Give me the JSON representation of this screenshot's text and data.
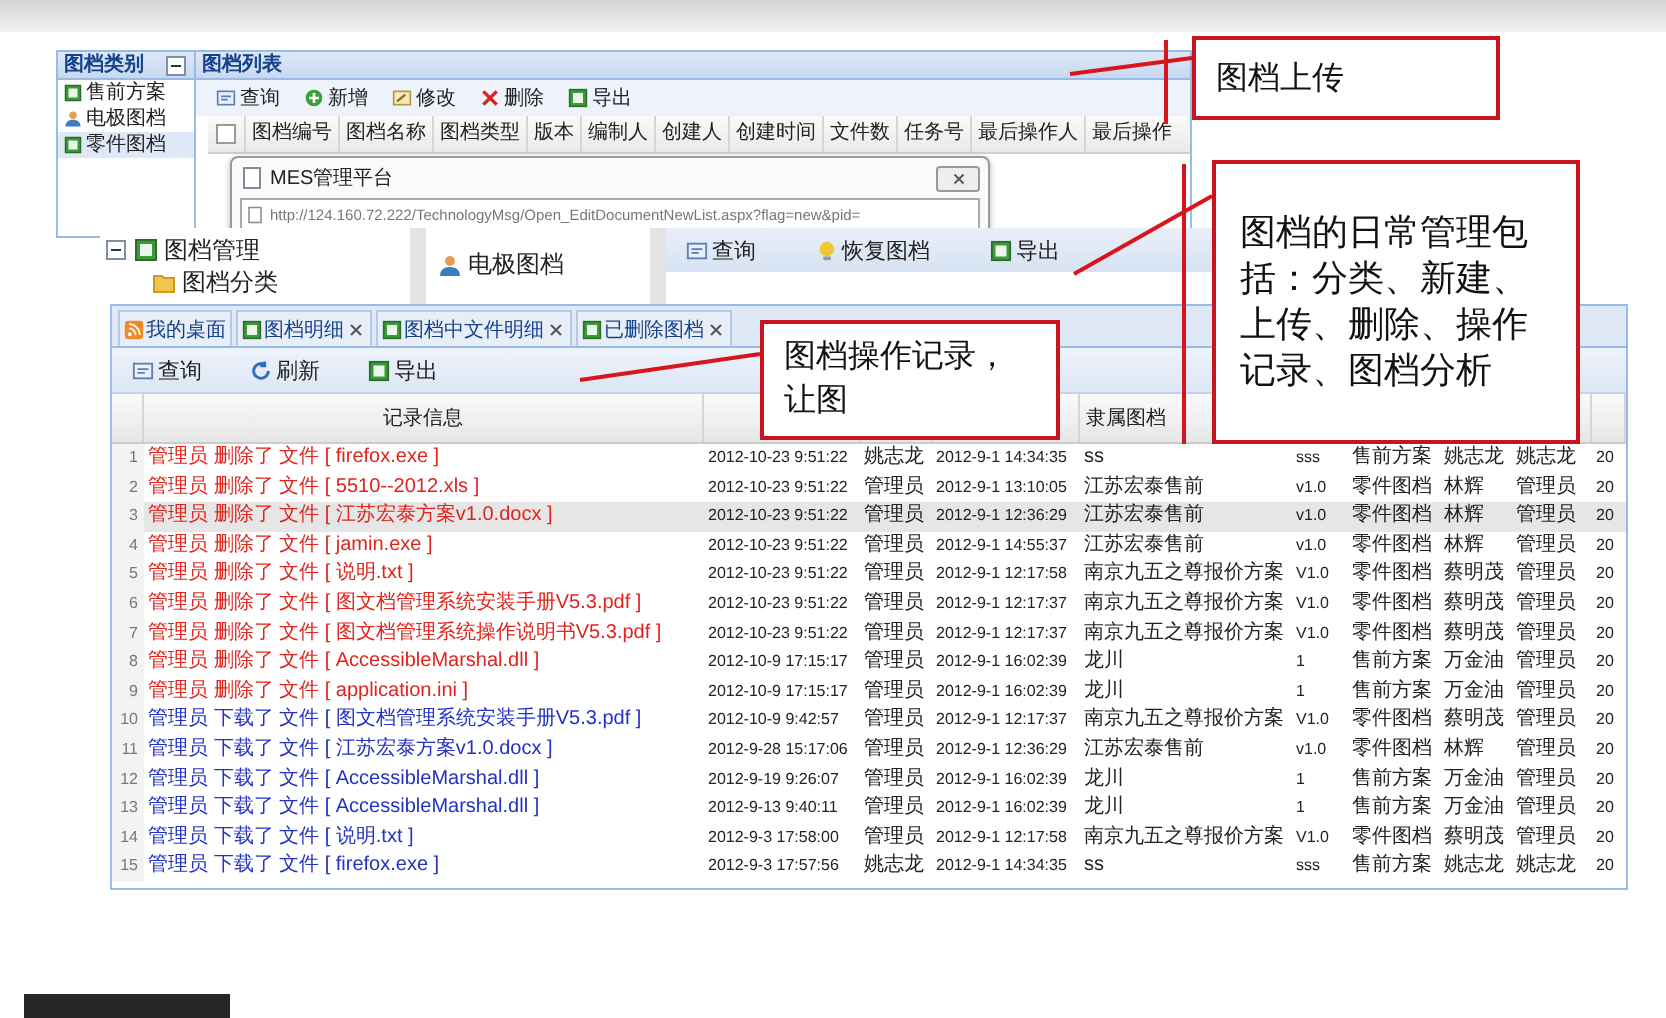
{
  "upload_screen": {
    "sidebar_title": "图档类别",
    "categories": [
      {
        "label": "售前方案",
        "selected": false
      },
      {
        "label": "电极图档",
        "selected": false
      },
      {
        "label": "零件图档",
        "selected": true
      }
    ],
    "panel_title": "图档列表",
    "toolbar": [
      "查询",
      "新增",
      "修改",
      "删除",
      "导出"
    ],
    "select_all_checked": false,
    "columns": [
      "图档编号",
      "图档名称",
      "图档类型",
      "版本",
      "编制人",
      "创建人",
      "创建时间",
      "文件数",
      "任务号",
      "最后操作人",
      "最后操作"
    ],
    "popup": {
      "title": "MES管理平台",
      "url": "http://124.160.72.222/TechnologyMsg/Open_EditDocumentNewList.aspx?flag=new&pid="
    }
  },
  "management_screen": {
    "tree": [
      {
        "label": "图档管理",
        "expanded": true,
        "children": [
          {
            "label": "图档分类"
          }
        ]
      }
    ],
    "list": [
      "电极图档"
    ],
    "toolbar": [
      "查询",
      "恢复图档",
      "导出"
    ]
  },
  "records_screen": {
    "tabs": [
      {
        "label": "我的桌面",
        "closable": false,
        "selected": false
      },
      {
        "label": "图档明细",
        "closable": true,
        "selected": false
      },
      {
        "label": "图档中文件明细",
        "closable": true,
        "selected": false
      },
      {
        "label": "已删除图档",
        "closable": true,
        "selected": false
      }
    ],
    "toolbar": [
      "查询",
      "刷新",
      "导出"
    ],
    "header": {
      "record": "记录信息",
      "document": "隶属图档"
    },
    "rows": [
      {
        "n": "1",
        "kind": "delete",
        "record": "管理员 删除了 文件 [ firefox.exe ]",
        "time": "2012-10-23 9:51:22",
        "user": "姚志龙",
        "created": "2012-9-1 14:34:35",
        "document": "ss",
        "version": "sss",
        "type": "售前方案",
        "author": "姚志龙",
        "operator": "姚志龙",
        "column_11": "20",
        "selected": false
      },
      {
        "n": "2",
        "kind": "delete",
        "record": "管理员 删除了 文件 [ 5510--2012.xls ]",
        "time": "2012-10-23 9:51:22",
        "user": "管理员",
        "created": "2012-9-1 13:10:05",
        "document": "江苏宏泰售前",
        "version": "v1.0",
        "type": "零件图档",
        "author": "林辉",
        "operator": "管理员",
        "column_11": "20",
        "selected": false
      },
      {
        "n": "3",
        "kind": "delete",
        "record": "管理员 删除了 文件 [ 江苏宏泰方案v1.0.docx ]",
        "time": "2012-10-23 9:51:22",
        "user": "管理员",
        "created": "2012-9-1 12:36:29",
        "document": "江苏宏泰售前",
        "version": "v1.0",
        "type": "零件图档",
        "author": "林辉",
        "operator": "管理员",
        "column_11": "20",
        "selected": true
      },
      {
        "n": "4",
        "kind": "delete",
        "record": "管理员 删除了 文件 [ jamin.exe ]",
        "time": "2012-10-23 9:51:22",
        "user": "管理员",
        "created": "2012-9-1 14:55:37",
        "document": "江苏宏泰售前",
        "version": "v1.0",
        "type": "零件图档",
        "author": "林辉",
        "operator": "管理员",
        "column_11": "20",
        "selected": false
      },
      {
        "n": "5",
        "kind": "delete",
        "record": "管理员 删除了 文件 [ 说明.txt ]",
        "time": "2012-10-23 9:51:22",
        "user": "管理员",
        "created": "2012-9-1 12:17:58",
        "document": "南京九五之尊报价方案",
        "version": "V1.0",
        "type": "零件图档",
        "author": "蔡明茂",
        "operator": "管理员",
        "column_11": "20",
        "selected": false
      },
      {
        "n": "6",
        "kind": "delete",
        "record": "管理员 删除了 文件 [ 图文档管理系统安装手册V5.3.pdf ]",
        "time": "2012-10-23 9:51:22",
        "user": "管理员",
        "created": "2012-9-1 12:17:37",
        "document": "南京九五之尊报价方案",
        "version": "V1.0",
        "type": "零件图档",
        "author": "蔡明茂",
        "operator": "管理员",
        "column_11": "20",
        "selected": false
      },
      {
        "n": "7",
        "kind": "delete",
        "record": "管理员 删除了 文件 [ 图文档管理系统操作说明书V5.3.pdf ]",
        "time": "2012-10-23 9:51:22",
        "user": "管理员",
        "created": "2012-9-1 12:17:37",
        "document": "南京九五之尊报价方案",
        "version": "V1.0",
        "type": "零件图档",
        "author": "蔡明茂",
        "operator": "管理员",
        "column_11": "20",
        "selected": false
      },
      {
        "n": "8",
        "kind": "delete",
        "record": "管理员 删除了 文件 [ AccessibleMarshal.dll ]",
        "time": "2012-10-9 17:15:17",
        "user": "管理员",
        "created": "2012-9-1 16:02:39",
        "document": "龙川",
        "version": "1",
        "type": "售前方案",
        "author": "万金油",
        "operator": "管理员",
        "column_11": "20",
        "selected": false
      },
      {
        "n": "9",
        "kind": "delete",
        "record": "管理员 删除了 文件 [ application.ini ]",
        "time": "2012-10-9 17:15:17",
        "user": "管理员",
        "created": "2012-9-1 16:02:39",
        "document": "龙川",
        "version": "1",
        "type": "售前方案",
        "author": "万金油",
        "operator": "管理员",
        "column_11": "20",
        "selected": false
      },
      {
        "n": "10",
        "kind": "download",
        "record": "管理员 下载了 文件 [ 图文档管理系统安装手册V5.3.pdf ]",
        "time": "2012-10-9 9:42:57",
        "user": "管理员",
        "created": "2012-9-1 12:17:37",
        "document": "南京九五之尊报价方案",
        "version": "V1.0",
        "type": "零件图档",
        "author": "蔡明茂",
        "operator": "管理员",
        "column_11": "20",
        "selected": false
      },
      {
        "n": "11",
        "kind": "download",
        "record": "管理员 下载了 文件 [ 江苏宏泰方案v1.0.docx ]",
        "time": "2012-9-28 15:17:06",
        "user": "管理员",
        "created": "2012-9-1 12:36:29",
        "document": "江苏宏泰售前",
        "version": "v1.0",
        "type": "零件图档",
        "author": "林辉",
        "operator": "管理员",
        "column_11": "20",
        "selected": false
      },
      {
        "n": "12",
        "kind": "download",
        "record": "管理员 下载了 文件 [ AccessibleMarshal.dll ]",
        "time": "2012-9-19 9:26:07",
        "user": "管理员",
        "created": "2012-9-1 16:02:39",
        "document": "龙川",
        "version": "1",
        "type": "售前方案",
        "author": "万金油",
        "operator": "管理员",
        "column_11": "20",
        "selected": false
      },
      {
        "n": "13",
        "kind": "download",
        "record": "管理员 下载了 文件 [ AccessibleMarshal.dll ]",
        "time": "2012-9-13 9:40:11",
        "user": "管理员",
        "created": "2012-9-1 16:02:39",
        "document": "龙川",
        "version": "1",
        "type": "售前方案",
        "author": "万金油",
        "operator": "管理员",
        "column_11": "20",
        "selected": false
      },
      {
        "n": "14",
        "kind": "download",
        "record": "管理员 下载了 文件 [ 说明.txt ]",
        "time": "2012-9-3 17:58:00",
        "user": "管理员",
        "created": "2012-9-1 12:17:58",
        "document": "南京九五之尊报价方案",
        "version": "V1.0",
        "type": "零件图档",
        "author": "蔡明茂",
        "operator": "管理员",
        "column_11": "20",
        "selected": false
      },
      {
        "n": "15",
        "kind": "download",
        "record": "管理员 下载了 文件 [ firefox.exe ]",
        "time": "2012-9-3 17:57:56",
        "user": "姚志龙",
        "created": "2012-9-1 14:34:35",
        "document": "ss",
        "version": "sss",
        "type": "售前方案",
        "author": "姚志龙",
        "operator": "姚志龙",
        "column_11": "20",
        "selected": false
      }
    ]
  },
  "callouts": [
    {
      "text": "图档上传"
    },
    {
      "text": "图档的日常管理包括：分类、新建、上传、删除、操作记录、图档分析"
    },
    {
      "text": "图档操作记录，让图"
    }
  ]
}
